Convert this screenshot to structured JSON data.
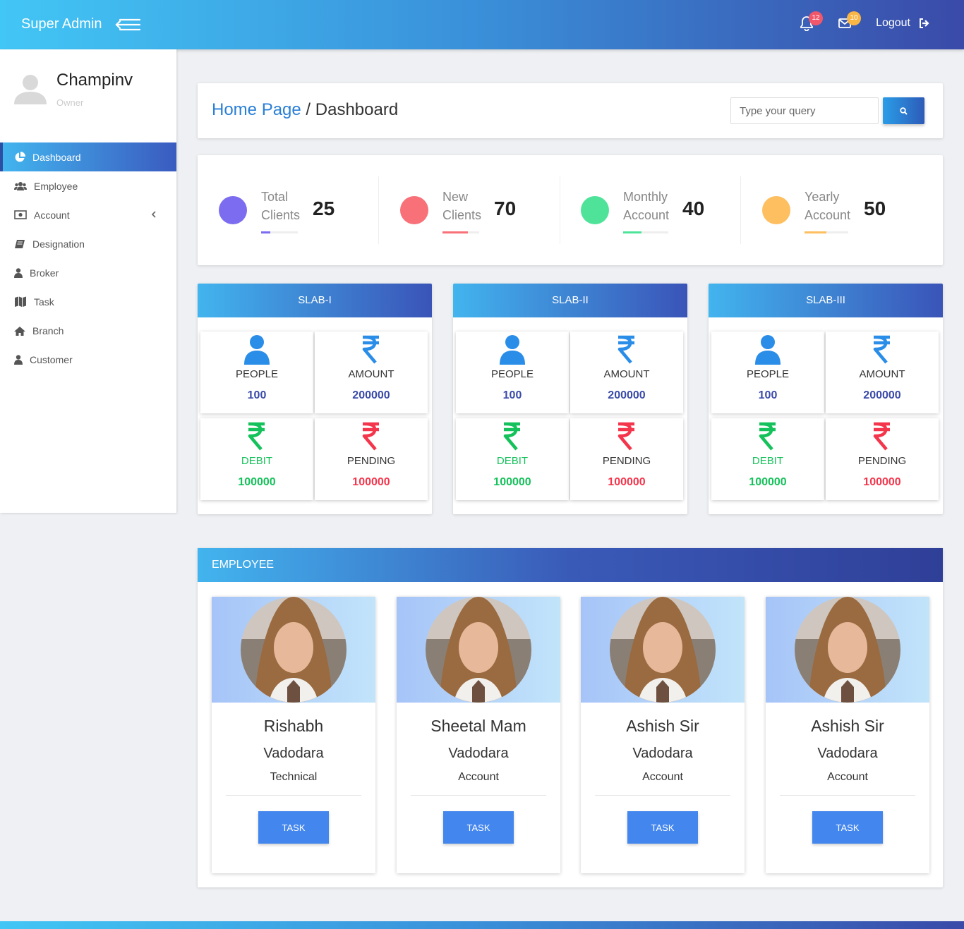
{
  "header": {
    "brand": "Super Admin",
    "notifications_count": "12",
    "messages_count": "10",
    "logout_label": "Logout"
  },
  "sidebar": {
    "profile_name": "Champinv",
    "profile_role": "Owner",
    "items": [
      {
        "label": "Dashboard",
        "icon": "pie-chart-icon",
        "active": true
      },
      {
        "label": "Employee",
        "icon": "users-icon"
      },
      {
        "label": "Account",
        "icon": "money-icon",
        "has_submenu": true
      },
      {
        "label": "Designation",
        "icon": "book-icon"
      },
      {
        "label": "Broker",
        "icon": "user-icon"
      },
      {
        "label": "Task",
        "icon": "map-icon"
      },
      {
        "label": "Branch",
        "icon": "home-icon"
      },
      {
        "label": "Customer",
        "icon": "user-icon"
      }
    ]
  },
  "breadcrumb": {
    "home": "Home Page",
    "separator": " / ",
    "current": "Dashboard",
    "search_placeholder": "Type your query"
  },
  "stats": [
    {
      "label": "Total Clients",
      "value": "25",
      "color": "#7b6cf0",
      "progress": 0.25
    },
    {
      "label": "New Clients",
      "value": "70",
      "color": "#f87078",
      "progress": 0.7
    },
    {
      "label": "Monthly Account",
      "value": "40",
      "color": "#4fe39a",
      "progress": 0.4
    },
    {
      "label": "Yearly Account",
      "value": "50",
      "color": "#fdbf60",
      "progress": 0.5
    }
  ],
  "slabs": [
    {
      "title": "SLAB-I",
      "people_label": "PEOPLE",
      "people": "100",
      "amount_label": "AMOUNT",
      "amount": "200000",
      "debit_label": "DEBIT",
      "debit": "100000",
      "pending_label": "PENDING",
      "pending": "100000"
    },
    {
      "title": "SLAB-II",
      "people_label": "PEOPLE",
      "people": "100",
      "amount_label": "AMOUNT",
      "amount": "200000",
      "debit_label": "DEBIT",
      "debit": "100000",
      "pending_label": "PENDING",
      "pending": "100000"
    },
    {
      "title": "SLAB-III",
      "people_label": "PEOPLE",
      "people": "100",
      "amount_label": "AMOUNT",
      "amount": "200000",
      "debit_label": "DEBIT",
      "debit": "100000",
      "pending_label": "PENDING",
      "pending": "100000"
    }
  ],
  "colors": {
    "accent_blue": "#2a8de8",
    "debit_green": "#15c15a",
    "pending_red": "#f4364c",
    "value_navy": "#3a4aa8"
  },
  "employee": {
    "title": "EMPLOYEE",
    "task_label": "TASK",
    "cards": [
      {
        "name": "Rishabh",
        "city": "Vadodara",
        "dept": "Technical"
      },
      {
        "name": "Sheetal Mam",
        "city": "Vadodara",
        "dept": "Account"
      },
      {
        "name": "Ashish Sir",
        "city": "Vadodara",
        "dept": "Account"
      },
      {
        "name": "Ashish Sir",
        "city": "Vadodara",
        "dept": "Account"
      }
    ]
  }
}
